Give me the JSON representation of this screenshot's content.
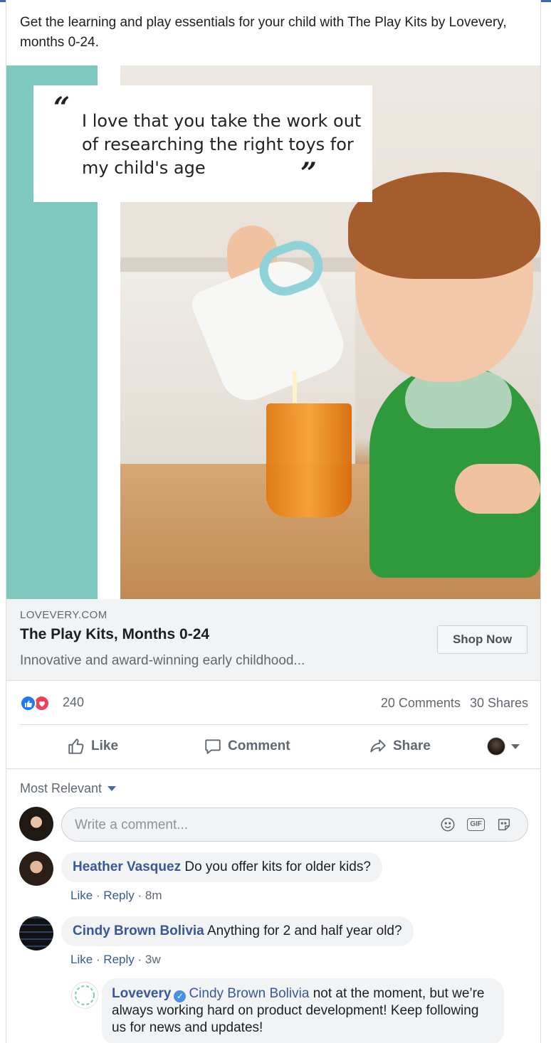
{
  "post": {
    "text": "Get the learning and play essentials for your child with The Play Kits by Lovevery, months 0-24."
  },
  "ad_image": {
    "quote_open": "“",
    "quote_close": "”",
    "quote_text": "I love that you take the work out of researching the right toys for my child's age",
    "teal_color": "#7fc8be"
  },
  "link": {
    "domain": "LOVEVERY.COM",
    "title": "The Play Kits, Months 0-24",
    "description": "Innovative and award-winning early childhood...",
    "cta": "Shop Now"
  },
  "stats": {
    "reaction_count": "240",
    "comments": "20 Comments",
    "shares": "30 Shares"
  },
  "actions": {
    "like": "Like",
    "comment": "Comment",
    "share": "Share"
  },
  "comments_section": {
    "sort_label": "Most Relevant",
    "input_placeholder": "Write a comment...",
    "items": [
      {
        "author": "Heather Vasquez",
        "text": "Do you offer kits for older kids?",
        "like": "Like",
        "reply": "Reply",
        "time": "8m"
      },
      {
        "author": "Cindy Brown Bolivia",
        "text": "Anything for 2 and half year old?",
        "like": "Like",
        "reply": "Reply",
        "time": "3w"
      }
    ],
    "reply": {
      "author": "Lovevery",
      "mention": "Cindy Brown Bolivia",
      "text": "not at the moment, but we’re always working hard on product development! Keep following us for news and updates!"
    }
  },
  "colors": {
    "link_blue": "#385898",
    "like_blue": "#2078f4",
    "love_red": "#f33e58",
    "muted": "#606770"
  }
}
